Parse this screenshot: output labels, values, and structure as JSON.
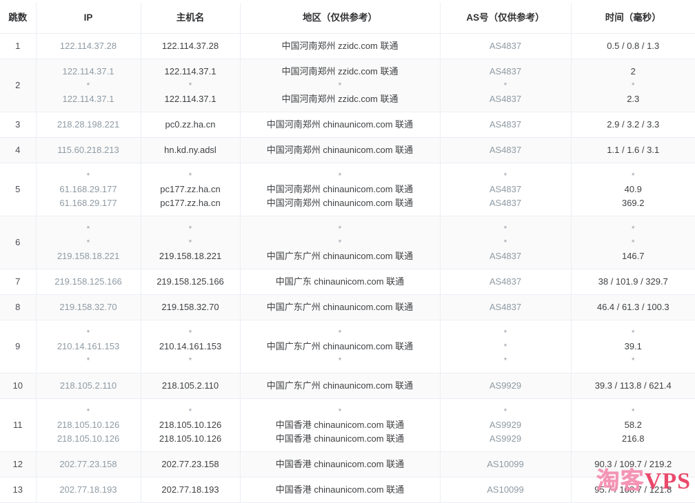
{
  "table": {
    "headers": [
      "跳数",
      "IP",
      "主机名",
      "地区（仅供参考）",
      "AS号（仅供参考）",
      "时间（毫秒）"
    ],
    "rows": [
      {
        "hop": "1",
        "ip": [
          "122.114.37.28"
        ],
        "host": [
          "122.114.37.28"
        ],
        "geo": [
          "中国河南郑州 zzidc.com 联通"
        ],
        "asn": [
          "AS4837"
        ],
        "time": [
          "0.5 / 0.8 / 1.3"
        ]
      },
      {
        "hop": "2",
        "ip": [
          "122.114.37.1",
          "*",
          "122.114.37.1"
        ],
        "host": [
          "122.114.37.1",
          "*",
          "122.114.37.1"
        ],
        "geo": [
          "中国河南郑州 zzidc.com 联通",
          "*",
          "中国河南郑州 zzidc.com 联通"
        ],
        "asn": [
          "AS4837",
          "*",
          "AS4837"
        ],
        "time": [
          "2",
          "*",
          "2.3"
        ]
      },
      {
        "hop": "3",
        "ip": [
          "218.28.198.221"
        ],
        "host": [
          "pc0.zz.ha.cn"
        ],
        "geo": [
          "中国河南郑州 chinaunicom.com 联通"
        ],
        "asn": [
          "AS4837"
        ],
        "time": [
          "2.9 / 3.2 / 3.3"
        ]
      },
      {
        "hop": "4",
        "ip": [
          "115.60.218.213"
        ],
        "host": [
          "hn.kd.ny.adsl"
        ],
        "geo": [
          "中国河南郑州 chinaunicom.com 联通"
        ],
        "asn": [
          "AS4837"
        ],
        "time": [
          "1.1 / 1.6 / 3.1"
        ]
      },
      {
        "hop": "5",
        "ip": [
          "*",
          "61.168.29.177",
          "61.168.29.177"
        ],
        "host": [
          "*",
          "pc177.zz.ha.cn",
          "pc177.zz.ha.cn"
        ],
        "geo": [
          "*",
          "中国河南郑州 chinaunicom.com 联通",
          "中国河南郑州 chinaunicom.com 联通"
        ],
        "asn": [
          "*",
          "AS4837",
          "AS4837"
        ],
        "time": [
          "*",
          "40.9",
          "369.2"
        ]
      },
      {
        "hop": "6",
        "ip": [
          "*",
          "*",
          "219.158.18.221"
        ],
        "host": [
          "*",
          "*",
          "219.158.18.221"
        ],
        "geo": [
          "*",
          "*",
          "中国广东广州 chinaunicom.com 联通"
        ],
        "asn": [
          "*",
          "*",
          "AS4837"
        ],
        "time": [
          "*",
          "*",
          "146.7"
        ]
      },
      {
        "hop": "7",
        "ip": [
          "219.158.125.166"
        ],
        "host": [
          "219.158.125.166"
        ],
        "geo": [
          "中国广东 chinaunicom.com 联通"
        ],
        "asn": [
          "AS4837"
        ],
        "time": [
          "38 / 101.9 / 329.7"
        ]
      },
      {
        "hop": "8",
        "ip": [
          "219.158.32.70"
        ],
        "host": [
          "219.158.32.70"
        ],
        "geo": [
          "中国广东广州 chinaunicom.com 联通"
        ],
        "asn": [
          "AS4837"
        ],
        "time": [
          "46.4 / 61.3 / 100.3"
        ]
      },
      {
        "hop": "9",
        "ip": [
          "*",
          "210.14.161.153",
          "*"
        ],
        "host": [
          "*",
          "210.14.161.153",
          "*"
        ],
        "geo": [
          "*",
          "中国广东广州 chinaunicom.com 联通",
          "*"
        ],
        "asn": [
          "*",
          "*",
          "*"
        ],
        "time": [
          "*",
          "39.1",
          "*"
        ]
      },
      {
        "hop": "10",
        "ip": [
          "218.105.2.110"
        ],
        "host": [
          "218.105.2.110"
        ],
        "geo": [
          "中国广东广州 chinaunicom.com 联通"
        ],
        "asn": [
          "AS9929"
        ],
        "time": [
          "39.3 / 113.8 / 621.4"
        ]
      },
      {
        "hop": "11",
        "ip": [
          "*",
          "218.105.10.126",
          "218.105.10.126"
        ],
        "host": [
          "*",
          "218.105.10.126",
          "218.105.10.126"
        ],
        "geo": [
          "*",
          "中国香港 chinaunicom.com 联通",
          "中国香港 chinaunicom.com 联通"
        ],
        "asn": [
          "*",
          "AS9929",
          "AS9929"
        ],
        "time": [
          "*",
          "58.2",
          "216.8"
        ]
      },
      {
        "hop": "12",
        "ip": [
          "202.77.23.158"
        ],
        "host": [
          "202.77.23.158"
        ],
        "geo": [
          "中国香港 chinaunicom.com 联通"
        ],
        "asn": [
          "AS10099"
        ],
        "time": [
          "90.3 / 109.7 / 219.2"
        ]
      },
      {
        "hop": "13",
        "ip": [
          "202.77.18.193"
        ],
        "host": [
          "202.77.18.193"
        ],
        "geo": [
          "中国香港 chinaunicom.com 联通"
        ],
        "asn": [
          "AS10099"
        ],
        "time": [
          "95.7 / 108.7 / 121.8"
        ]
      }
    ]
  },
  "watermark": {
    "cn": "淘客",
    "en": "VPS"
  },
  "colors": {
    "link": "#8e9aa3",
    "border": "#ebeef5",
    "alt_row": "#fafafa",
    "watermark_cn": "#f48fb1",
    "watermark_en": "#e8365c"
  }
}
